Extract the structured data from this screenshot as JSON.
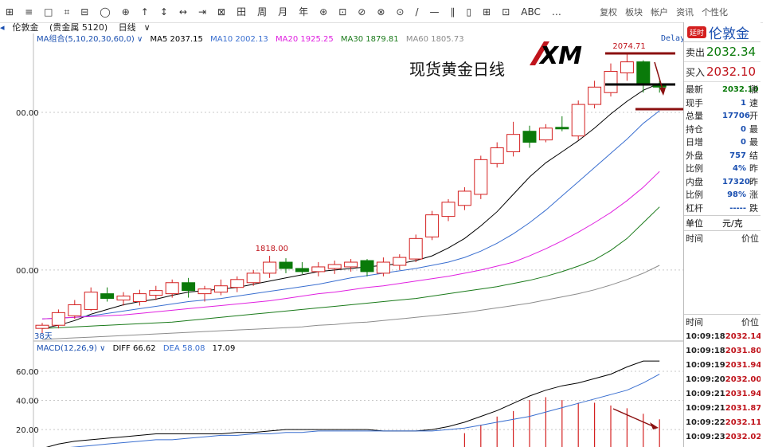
{
  "toolbar": {
    "items": [
      "⊞",
      "≡",
      "□",
      "⌗",
      "⊟",
      "◯",
      "⊕",
      "↑",
      "↕",
      "↔",
      "⇥",
      "⊠",
      "田",
      "周",
      "月",
      "年",
      "⊛",
      "⊡",
      "⊘",
      "⊗",
      "⊙",
      "/",
      "—",
      "∥",
      "▯",
      "⊞",
      "⊡",
      "ABC",
      "…"
    ],
    "links": [
      "复权",
      "板块",
      "帐户",
      "资讯",
      "个性化"
    ]
  },
  "symbol_bar": {
    "name": "伦敦金",
    "category": "(贵金属 5120)",
    "period": "日线"
  },
  "ma_legend": {
    "group": "MA组合(5,10,20,30,60,0)",
    "items": [
      {
        "label": "MA5 2037.15",
        "color": "#000000"
      },
      {
        "label": "MA10 2002.13",
        "color": "#3a6fd0"
      },
      {
        "label": "MA20 1925.25",
        "color": "#e020e0"
      },
      {
        "label": "MA30 1879.81",
        "color": "#1a7a1a"
      },
      {
        "label": "MA60 1805.73",
        "color": "#8c8c8c"
      }
    ]
  },
  "delay_label": "Delay",
  "chart_title": "现货黄金日线",
  "logo_text": "XM",
  "days_label": "38天",
  "macd_legend": {
    "label": "MACD(12,26,9)",
    "diff": "DIFF 66.62",
    "dea": "DEA 58.08",
    "macd": "17.09"
  },
  "colors": {
    "up": "#d42020",
    "down": "#0a7a0a",
    "diff": "#000000",
    "dea": "#3a6fd0",
    "arrow": "#8b1010",
    "accent": "#c0141c"
  },
  "chart_data": [
    {
      "type": "candlestick",
      "title": "现货黄金日线",
      "y_tick_labels": [
        "00.00",
        "00.00"
      ],
      "y_ticks": [
        2000,
        1800
      ],
      "ylim": [
        1710,
        2100
      ],
      "annotations": [
        {
          "text": "1818.00",
          "candle": 14
        },
        {
          "text": "2074.71",
          "candle": 36
        }
      ],
      "candles": [
        {
          "o": 1726,
          "h": 1733,
          "l": 1720,
          "c": 1730
        },
        {
          "o": 1730,
          "h": 1750,
          "l": 1726,
          "c": 1746
        },
        {
          "o": 1742,
          "h": 1762,
          "l": 1738,
          "c": 1756
        },
        {
          "o": 1750,
          "h": 1778,
          "l": 1748,
          "c": 1772
        },
        {
          "o": 1770,
          "h": 1778,
          "l": 1760,
          "c": 1764
        },
        {
          "o": 1762,
          "h": 1772,
          "l": 1755,
          "c": 1767
        },
        {
          "o": 1760,
          "h": 1775,
          "l": 1755,
          "c": 1770
        },
        {
          "o": 1768,
          "h": 1780,
          "l": 1762,
          "c": 1774
        },
        {
          "o": 1770,
          "h": 1788,
          "l": 1765,
          "c": 1784
        },
        {
          "o": 1784,
          "h": 1790,
          "l": 1765,
          "c": 1774
        },
        {
          "o": 1770,
          "h": 1780,
          "l": 1760,
          "c": 1776
        },
        {
          "o": 1772,
          "h": 1788,
          "l": 1768,
          "c": 1780
        },
        {
          "o": 1778,
          "h": 1792,
          "l": 1772,
          "c": 1788
        },
        {
          "o": 1784,
          "h": 1800,
          "l": 1780,
          "c": 1796
        },
        {
          "o": 1796,
          "h": 1818,
          "l": 1790,
          "c": 1810
        },
        {
          "o": 1810,
          "h": 1815,
          "l": 1796,
          "c": 1802
        },
        {
          "o": 1802,
          "h": 1810,
          "l": 1795,
          "c": 1798
        },
        {
          "o": 1798,
          "h": 1810,
          "l": 1792,
          "c": 1804
        },
        {
          "o": 1802,
          "h": 1812,
          "l": 1795,
          "c": 1807
        },
        {
          "o": 1804,
          "h": 1814,
          "l": 1798,
          "c": 1810
        },
        {
          "o": 1812,
          "h": 1814,
          "l": 1792,
          "c": 1798
        },
        {
          "o": 1796,
          "h": 1816,
          "l": 1792,
          "c": 1810
        },
        {
          "o": 1806,
          "h": 1820,
          "l": 1800,
          "c": 1816
        },
        {
          "o": 1814,
          "h": 1845,
          "l": 1810,
          "c": 1840
        },
        {
          "o": 1842,
          "h": 1875,
          "l": 1838,
          "c": 1870
        },
        {
          "o": 1868,
          "h": 1890,
          "l": 1862,
          "c": 1886
        },
        {
          "o": 1882,
          "h": 1905,
          "l": 1876,
          "c": 1900
        },
        {
          "o": 1896,
          "h": 1945,
          "l": 1890,
          "c": 1940
        },
        {
          "o": 1935,
          "h": 1962,
          "l": 1930,
          "c": 1955
        },
        {
          "o": 1950,
          "h": 1988,
          "l": 1944,
          "c": 1972
        },
        {
          "o": 1976,
          "h": 1983,
          "l": 1955,
          "c": 1962
        },
        {
          "o": 1965,
          "h": 1985,
          "l": 1962,
          "c": 1980
        },
        {
          "o": 1981,
          "h": 1995,
          "l": 1976,
          "c": 1979
        },
        {
          "o": 1970,
          "h": 2015,
          "l": 1965,
          "c": 2010
        },
        {
          "o": 2010,
          "h": 2040,
          "l": 2005,
          "c": 2032
        },
        {
          "o": 2025,
          "h": 2062,
          "l": 2020,
          "c": 2052
        },
        {
          "o": 2050,
          "h": 2074.71,
          "l": 2040,
          "c": 2064
        },
        {
          "o": 2064,
          "h": 2066,
          "l": 2025,
          "c": 2036
        },
        {
          "o": 2036,
          "h": 2040,
          "l": 2025,
          "c": 2032
        }
      ],
      "series": [
        {
          "name": "MA5",
          "values": [
            1726,
            1730,
            1736,
            1744,
            1750,
            1756,
            1760,
            1763,
            1768,
            1772,
            1774,
            1776,
            1778,
            1782,
            1786,
            1790,
            1794,
            1798,
            1800,
            1802,
            1804,
            1806,
            1808,
            1812,
            1818,
            1828,
            1840,
            1856,
            1874,
            1896,
            1918,
            1936,
            1950,
            1964,
            1980,
            1998,
            2014,
            2028,
            2037
          ]
        },
        {
          "name": "MA10",
          "values": [
            1738,
            1739,
            1740,
            1742,
            1745,
            1748,
            1751,
            1754,
            1757,
            1760,
            1762,
            1764,
            1767,
            1770,
            1773,
            1776,
            1779,
            1782,
            1786,
            1790,
            1793,
            1796,
            1799,
            1802,
            1806,
            1810,
            1816,
            1824,
            1834,
            1846,
            1860,
            1876,
            1894,
            1912,
            1930,
            1948,
            1966,
            1986,
            2002
          ]
        },
        {
          "name": "MA20",
          "values": [
            1738,
            1739,
            1740,
            1741,
            1742,
            1743,
            1745,
            1747,
            1749,
            1751,
            1753,
            1755,
            1757,
            1759,
            1761,
            1764,
            1767,
            1770,
            1772,
            1775,
            1778,
            1780,
            1783,
            1786,
            1789,
            1792,
            1796,
            1800,
            1805,
            1810,
            1818,
            1827,
            1837,
            1848,
            1860,
            1873,
            1888,
            1905,
            1925
          ]
        },
        {
          "name": "MA30",
          "values": [
            1726,
            1727,
            1728,
            1729,
            1730,
            1731,
            1732,
            1733,
            1734,
            1736,
            1738,
            1740,
            1742,
            1744,
            1746,
            1748,
            1750,
            1752,
            1754,
            1756,
            1758,
            1760,
            1762,
            1764,
            1767,
            1770,
            1773,
            1776,
            1779,
            1783,
            1787,
            1792,
            1798,
            1805,
            1813,
            1825,
            1840,
            1860,
            1880
          ]
        },
        {
          "name": "MA60",
          "values": [
            1712,
            1713,
            1714,
            1715,
            1716,
            1717,
            1718,
            1719,
            1720,
            1721,
            1722,
            1723,
            1724,
            1725,
            1726,
            1727,
            1728,
            1730,
            1731,
            1733,
            1734,
            1736,
            1738,
            1740,
            1742,
            1744,
            1746,
            1749,
            1752,
            1755,
            1758,
            1762,
            1766,
            1770,
            1775,
            1781,
            1788,
            1796,
            1806
          ]
        }
      ]
    },
    {
      "type": "line",
      "title": "MACD(12,26,9)",
      "y_tick_labels": [
        "60.00",
        "40.00",
        "20.00"
      ],
      "y_ticks": [
        60,
        40,
        20
      ],
      "ylim": [
        8,
        72
      ],
      "series": [
        {
          "name": "DIFF",
          "values": [
            7,
            10,
            12,
            13,
            14,
            15,
            16,
            17,
            17,
            17,
            17,
            17,
            18,
            18,
            19,
            20,
            20,
            20,
            20,
            20,
            20,
            19,
            19,
            19,
            20,
            22,
            25,
            29,
            33,
            38,
            43,
            47,
            50,
            52,
            55,
            58,
            63,
            67,
            67
          ]
        },
        {
          "name": "DEA",
          "values": [
            5,
            7,
            8,
            9,
            10,
            11,
            12,
            13,
            13,
            14,
            15,
            16,
            16,
            17,
            17,
            18,
            18,
            19,
            19,
            19,
            19,
            19,
            19,
            19,
            19,
            20,
            21,
            23,
            25,
            27,
            29,
            32,
            35,
            38,
            41,
            44,
            47,
            52,
            58
          ]
        }
      ],
      "bars": [
        0,
        0,
        0,
        0,
        0,
        0,
        0,
        0,
        0,
        0,
        0,
        0,
        0,
        0,
        0,
        0,
        0,
        0,
        0,
        0,
        0,
        0,
        0,
        0,
        0,
        0,
        5,
        8,
        11,
        13,
        17,
        18,
        17,
        16,
        16,
        15,
        14,
        12,
        10
      ]
    }
  ],
  "quote": {
    "live_badge": "延时",
    "symbol": "伦敦金",
    "sell_label": "卖出",
    "sell_value": "2032.34",
    "buy_label": "买入",
    "buy_value": "2032.10",
    "rows": [
      {
        "label": "最新",
        "value": "2032.10",
        "cut": "涨",
        "color": "#0a7a0a"
      },
      {
        "label": "现手",
        "value": "1",
        "cut": "速",
        "color": "#1a4fb0"
      },
      {
        "label": "总量",
        "value": "17706",
        "cut": "开",
        "color": "#1a4fb0"
      },
      {
        "label": "持仓",
        "value": "0",
        "cut": "最",
        "color": "#1a4fb0"
      },
      {
        "label": "日增",
        "value": "0",
        "cut": "最",
        "color": "#1a4fb0"
      },
      {
        "label": "外盘",
        "value": "757",
        "cut": "结",
        "color": "#1a4fb0"
      },
      {
        "label": "比例",
        "value": "4%",
        "cut": "昨",
        "color": "#1a4fb0"
      },
      {
        "label": "内盘",
        "value": "17320",
        "cut": "昨",
        "color": "#1a4fb0"
      },
      {
        "label": "比例",
        "value": "98%",
        "cut": "涨",
        "color": "#1a4fb0"
      },
      {
        "label": "杠杆",
        "value": "-----",
        "cut": "跌",
        "color": "#1a4fb0"
      }
    ],
    "unit_label": "单位",
    "unit_value": "元/克",
    "time_header": "时间",
    "price_header": "价位",
    "ticks": [
      {
        "time": "10:09:18",
        "price": "2032.14"
      },
      {
        "time": "10:09:18",
        "price": "2031.80"
      },
      {
        "time": "10:09:19",
        "price": "2031.94"
      },
      {
        "time": "10:09:20",
        "price": "2032.00"
      },
      {
        "time": "10:09:21",
        "price": "2031.94"
      },
      {
        "time": "10:09:21",
        "price": "2031.87"
      },
      {
        "time": "10:09:22",
        "price": "2032.11"
      },
      {
        "time": "10:09:23",
        "price": "2032.02"
      }
    ]
  }
}
